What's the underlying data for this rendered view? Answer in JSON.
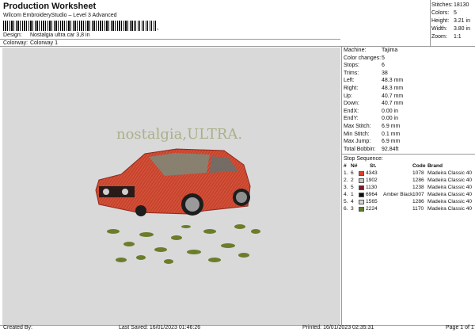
{
  "header": {
    "title": "Production Worksheet",
    "subtitle": "Wilcom EmbroideryStudio – Level 3 Advanced",
    "barcode_suffix": ","
  },
  "design": {
    "label": "Design:",
    "value": "Nostalgia ultra car 3,8 in"
  },
  "colorway": {
    "label": "Colorway:",
    "value": "Colorway 1"
  },
  "stats": [
    {
      "label": "Stitches:",
      "value": "18130"
    },
    {
      "label": "Colors:",
      "value": "5"
    },
    {
      "label": "Height:",
      "value": "3.21 in"
    },
    {
      "label": "Width:",
      "value": "3.80 in"
    },
    {
      "label": "Zoom:",
      "value": "1:1"
    }
  ],
  "preview": {
    "logo_text": "nostalgia,ULTRA."
  },
  "specs": [
    {
      "label": "Machine:",
      "value": "Tajima"
    },
    {
      "label": "Color changes:",
      "value": "5"
    },
    {
      "label": "Stops:",
      "value": "6"
    },
    {
      "label": "Trims:",
      "value": "38"
    },
    {
      "label": "Left:",
      "value": "48.3 mm"
    },
    {
      "label": "Right:",
      "value": "48.3 mm"
    },
    {
      "label": "Up:",
      "value": "40.7 mm"
    },
    {
      "label": "Down:",
      "value": "40.7 mm"
    },
    {
      "label": "EndX:",
      "value": "0.00 in"
    },
    {
      "label": "EndY:",
      "value": "0.00 in"
    },
    {
      "label": "Max Stitch:",
      "value": "6.9 mm"
    },
    {
      "label": "Min Stitch:",
      "value": "0.1 mm"
    },
    {
      "label": "Max Jump:",
      "value": "6.9 mm"
    },
    {
      "label": "Total Bobbin:",
      "value": "92.84ft"
    }
  ],
  "stop_sequence": {
    "title": "Stop Sequence:",
    "columns": [
      "#",
      "N#",
      "St.",
      "Code",
      "Brand"
    ],
    "rows": [
      {
        "num": "1.",
        "n": "6",
        "color": "#d9412c",
        "code_num": "4343",
        "name": "",
        "stitches": "1078",
        "brand": "Madeira Classic 40"
      },
      {
        "num": "2.",
        "n": "2",
        "color": "#c8c8c8",
        "code_num": "1902",
        "name": "",
        "stitches": "1286",
        "brand": "Madeira Classic 40"
      },
      {
        "num": "3.",
        "n": "5",
        "color": "#7a1a22",
        "code_num": "1130",
        "name": "",
        "stitches": "1238",
        "brand": "Madeira Classic 40"
      },
      {
        "num": "4.",
        "n": "1",
        "color": "#111111",
        "code_num": "6964",
        "name": "Amber Black",
        "stitches": "1007",
        "brand": "Madeira Classic 40"
      },
      {
        "num": "5.",
        "n": "4",
        "color": "#d6d6d6",
        "code_num": "1565",
        "name": "",
        "stitches": "1286",
        "brand": "Madeira Classic 40"
      },
      {
        "num": "6.",
        "n": "3",
        "color": "#5f7a2b",
        "code_num": "2224",
        "name": "",
        "stitches": "1170",
        "brand": "Madeira Classic 40"
      }
    ]
  },
  "footer": {
    "created_by": "Created By:",
    "last_saved": "Last Saved: 16/01/2023 01:46:26",
    "printed": "Printed: 16/01/2023 02:35:31",
    "page": "Page 1 of 1"
  }
}
